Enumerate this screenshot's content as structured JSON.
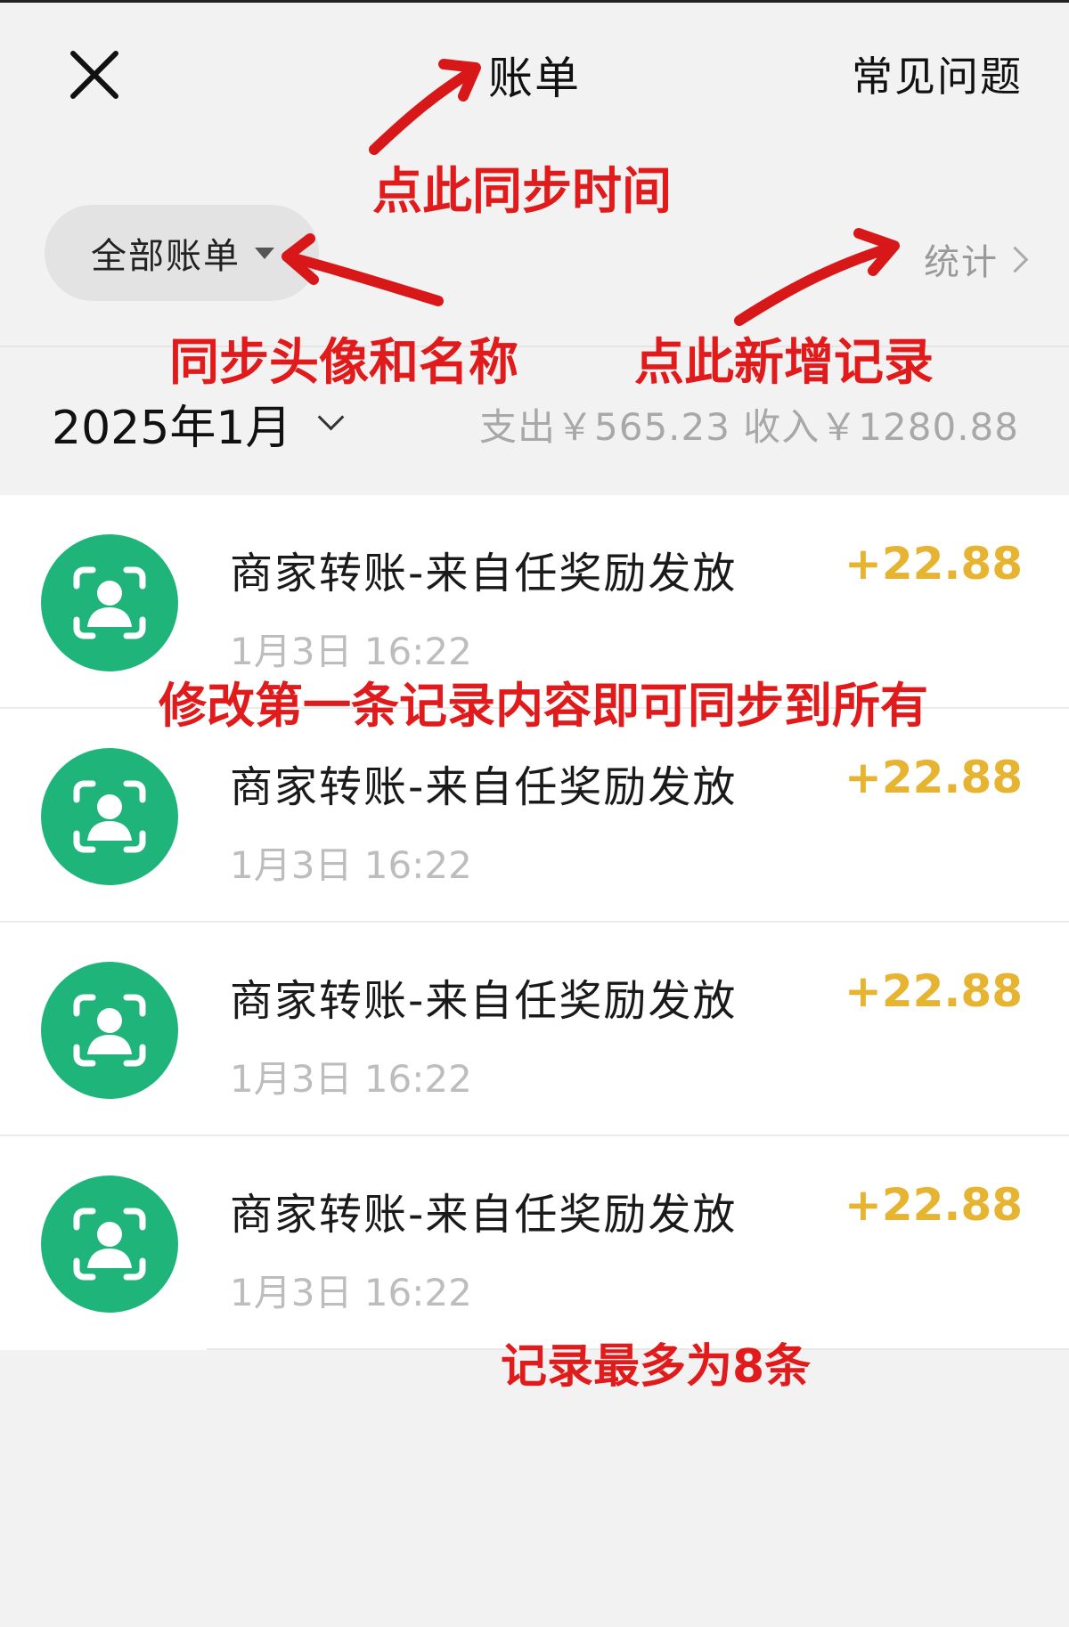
{
  "header": {
    "title": "账单",
    "faq_label": "常见问题"
  },
  "filter": {
    "label": "全部账单",
    "stats_label": "统计"
  },
  "month": {
    "label": "2025年1月",
    "summary": "支出￥565.23 收入￥1280.88"
  },
  "transactions": [
    {
      "title": "商家转账-来自任奖励发放",
      "time": "1月3日 16:22",
      "amount": "+22.88"
    },
    {
      "title": "商家转账-来自任奖励发放",
      "time": "1月3日 16:22",
      "amount": "+22.88"
    },
    {
      "title": "商家转账-来自任奖励发放",
      "time": "1月3日 16:22",
      "amount": "+22.88"
    },
    {
      "title": "商家转账-来自任奖励发放",
      "time": "1月3日 16:22",
      "amount": "+22.88"
    }
  ],
  "annotations": {
    "sync_time": "点此同步时间",
    "sync_avatar": "同步头像和名称",
    "add_record": "点此新增记录",
    "edit_first": "修改第一条记录内容即可同步到所有",
    "max_records": "记录最多为8条"
  },
  "colors": {
    "avatar_bg": "#1fb57a",
    "amount": "#e6b431",
    "annotation": "#e11b1b",
    "page_bg": "#f2f2f2"
  },
  "icons": {
    "close": "close-icon",
    "filter_caret": "caret-down-icon",
    "stats_chevron": "chevron-right-icon",
    "month_chevron": "chevron-down-icon",
    "avatar": "person-scan-icon"
  }
}
